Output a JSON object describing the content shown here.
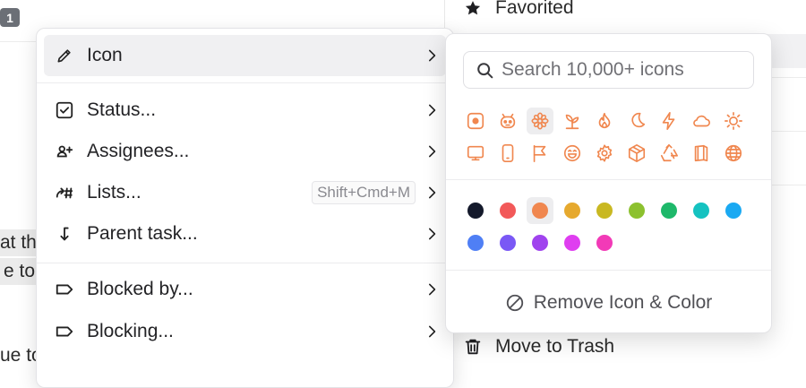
{
  "background": {
    "badge": "1",
    "partial_texts": [
      "at th",
      "e to",
      "ue to"
    ]
  },
  "side_menu": {
    "favorited": "Favorited",
    "move_to_trash": "Move to Trash"
  },
  "context_menu": {
    "items": [
      {
        "label": "Icon",
        "icon": "pencil-icon",
        "shortcut": "",
        "submenu": true,
        "active": true
      },
      {
        "label": "Status...",
        "icon": "checkbox-icon",
        "shortcut": "",
        "submenu": true
      },
      {
        "label": "Assignees...",
        "icon": "assignee-icon",
        "shortcut": "",
        "submenu": true
      },
      {
        "label": "Lists...",
        "icon": "lists-icon",
        "shortcut": "Shift+Cmd+M",
        "submenu": true
      },
      {
        "label": "Parent task...",
        "icon": "parent-arrow-icon",
        "shortcut": "",
        "submenu": true
      },
      {
        "label": "Blocked by...",
        "icon": "tag-icon",
        "shortcut": "",
        "submenu": true
      },
      {
        "label": "Blocking...",
        "icon": "tag-icon",
        "shortcut": "",
        "submenu": true
      }
    ]
  },
  "icon_picker": {
    "search_placeholder": "Search 10,000+ icons",
    "icon_color": "#f0874f",
    "icons": [
      "target-icon",
      "robot-icon",
      "flower-icon",
      "sprout-icon",
      "flame-icon",
      "moon-icon",
      "lightning-icon",
      "cloud-icon",
      "sun-icon",
      "monitor-icon",
      "phone-icon",
      "flag-icon",
      "grin-face-icon",
      "gear-icon",
      "box-icon",
      "recycle-icon",
      "book-icon",
      "globe-icon"
    ],
    "selected_icon": "flower-icon",
    "colors": [
      "#14192b",
      "#f25959",
      "#f0874f",
      "#e6a92e",
      "#c9b822",
      "#8cc12f",
      "#1eb86a",
      "#15c2c0",
      "#1aa9f2",
      "#4f7ff5",
      "#7a58f5",
      "#a043ee",
      "#df3ef0",
      "#f23ab7"
    ],
    "selected_color": "#f0874f",
    "remove_label": "Remove Icon & Color"
  }
}
